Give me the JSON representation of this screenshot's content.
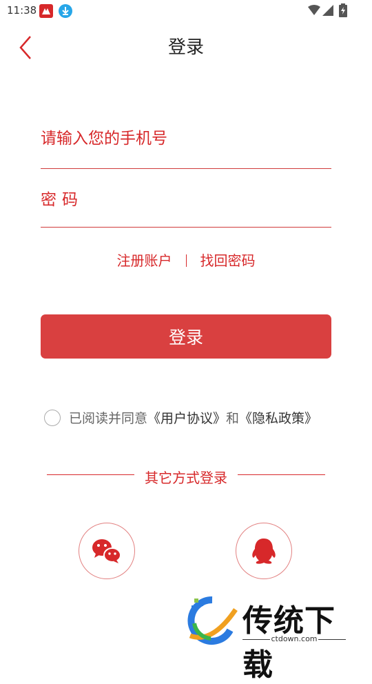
{
  "status_bar": {
    "time": "11:38",
    "icons": [
      "app-notification-icon",
      "download-notification-icon",
      "wifi-icon",
      "signal-icon",
      "battery-icon"
    ]
  },
  "header": {
    "title": "登录",
    "back_icon": "chevron-left-icon"
  },
  "form": {
    "phone_placeholder": "请输入您的手机号",
    "password_placeholder": "密码"
  },
  "links": {
    "register": "注册账户",
    "forgot_password": "找回密码"
  },
  "login_button": "登录",
  "agreement": {
    "prefix": "已阅读并同意",
    "user_agreement": "《用户协议》",
    "and": "和",
    "privacy_policy": "《隐私政策》"
  },
  "other_login": {
    "label": "其它方式登录",
    "options": [
      "wechat-icon",
      "qq-icon"
    ]
  },
  "watermark": {
    "text": "传统下载",
    "url": "ctdown.com"
  },
  "colors": {
    "accent": "#d7282a",
    "button": "#d94040"
  }
}
